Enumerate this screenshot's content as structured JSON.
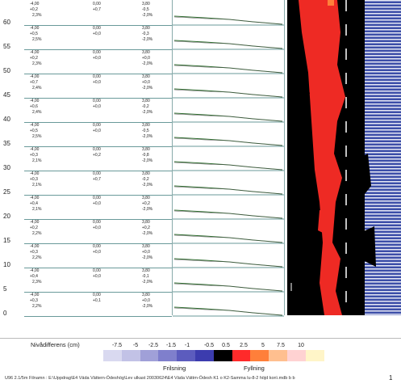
{
  "y_ticks": [
    "60",
    "55",
    "50",
    "45",
    "40",
    "35",
    "30",
    "25",
    "20",
    "15",
    "10",
    "5",
    "0"
  ],
  "rows": [
    {
      "a": "-4,00",
      "b": "0,00",
      "c": "3,80",
      "d": "+0,2",
      "e": "+0,7",
      "f": "-0,5",
      "g": "2,3%",
      "h": "-2,0%"
    },
    {
      "a": "-4,00",
      "b": "0,00",
      "c": "3,80",
      "d": "+0,5",
      "e": "+0,0",
      "f": "-0,3",
      "g": "2,5%",
      "h": "-2,0%"
    },
    {
      "a": "-4,00",
      "b": "0,00",
      "c": "3,80",
      "d": "+0,2",
      "e": "+0,0",
      "f": "+0,0",
      "g": "2,3%",
      "h": "-2,0%"
    },
    {
      "a": "-4,00",
      "b": "0,00",
      "c": "3,80",
      "d": "+0,7",
      "e": "+0,0",
      "f": "+0,0",
      "g": "2,4%",
      "h": "-2,0%"
    },
    {
      "a": "-4,00",
      "b": "0,00",
      "c": "3,80",
      "d": "+0,6",
      "e": "+0,0",
      "f": "-0,2",
      "g": "2,4%",
      "h": "-2,0%"
    },
    {
      "a": "-4,00",
      "b": "0,00",
      "c": "3,80",
      "d": "+0,5",
      "e": "+0,0",
      "f": "-0,5",
      "g": "2,5%",
      "h": "-2,0%"
    },
    {
      "a": "-4,00",
      "b": "0,00",
      "c": "3,80",
      "d": "+0,3",
      "e": "+0,2",
      "f": "-0,8",
      "g": "2,1%",
      "h": "-2,0%"
    },
    {
      "a": "-4,00",
      "b": "0,00",
      "c": "3,80",
      "d": "+0,3",
      "e": "+0,7",
      "f": "-0,2",
      "g": "2,1%",
      "h": "-2,0%"
    },
    {
      "a": "-4,00",
      "b": "0,00",
      "c": "3,80",
      "d": "+0,4",
      "e": "+0,0",
      "f": "+0,2",
      "g": "2,1%",
      "h": "-2,0%"
    },
    {
      "a": "-4,00",
      "b": "0,00",
      "c": "3,80",
      "d": "+0,2",
      "e": "+0,0",
      "f": "+0,2",
      "g": "2,2%",
      "h": "-2,0%"
    },
    {
      "a": "-4,00",
      "b": "0,00",
      "c": "3,80",
      "d": "+0,3",
      "e": "+0,0",
      "f": "+0,0",
      "g": "2,2%",
      "h": "-2,0%"
    },
    {
      "a": "-4,00",
      "b": "0,00",
      "c": "3,80",
      "d": "+0,4",
      "e": "+0,0",
      "f": "-0,1",
      "g": "2,3%",
      "h": "-2,0%"
    },
    {
      "a": "-4,00",
      "b": "0,00",
      "c": "3,80",
      "d": "+0,3",
      "e": "+0,1",
      "f": "+0,0",
      "g": "2,2%",
      "h": "-2,0%"
    }
  ],
  "legend": {
    "title": "Nivådifferens (cm)",
    "values": [
      "-7.5",
      "-5",
      "-2.5",
      "-1.5",
      "-1",
      "-0.5",
      "0.5",
      "2.5",
      "5",
      "7.5",
      "10"
    ],
    "cut_label": "Frilsning",
    "fill_label": "Fyllning",
    "colors": [
      "#d9d9f0",
      "#c2c2e6",
      "#a0a0d8",
      "#7f7fcc",
      "#5c5cbe",
      "#3c3cae",
      "#000000",
      "#ff2a2a",
      "#ff7f3a",
      "#ffbf8f",
      "#ffd2d2",
      "#fff5c8"
    ]
  },
  "footer": {
    "text": "U96 2.1/5m  Filnamn : E:\\Uppdrag\\E4 Väda Vättern-Ödeshög\\Lev ulkast 20030624\\E4 Väda Vättm-Ödesh K1 o K2-Samma lu-8-2 höjd kon\\.mdb  b  b",
    "page": "1"
  }
}
